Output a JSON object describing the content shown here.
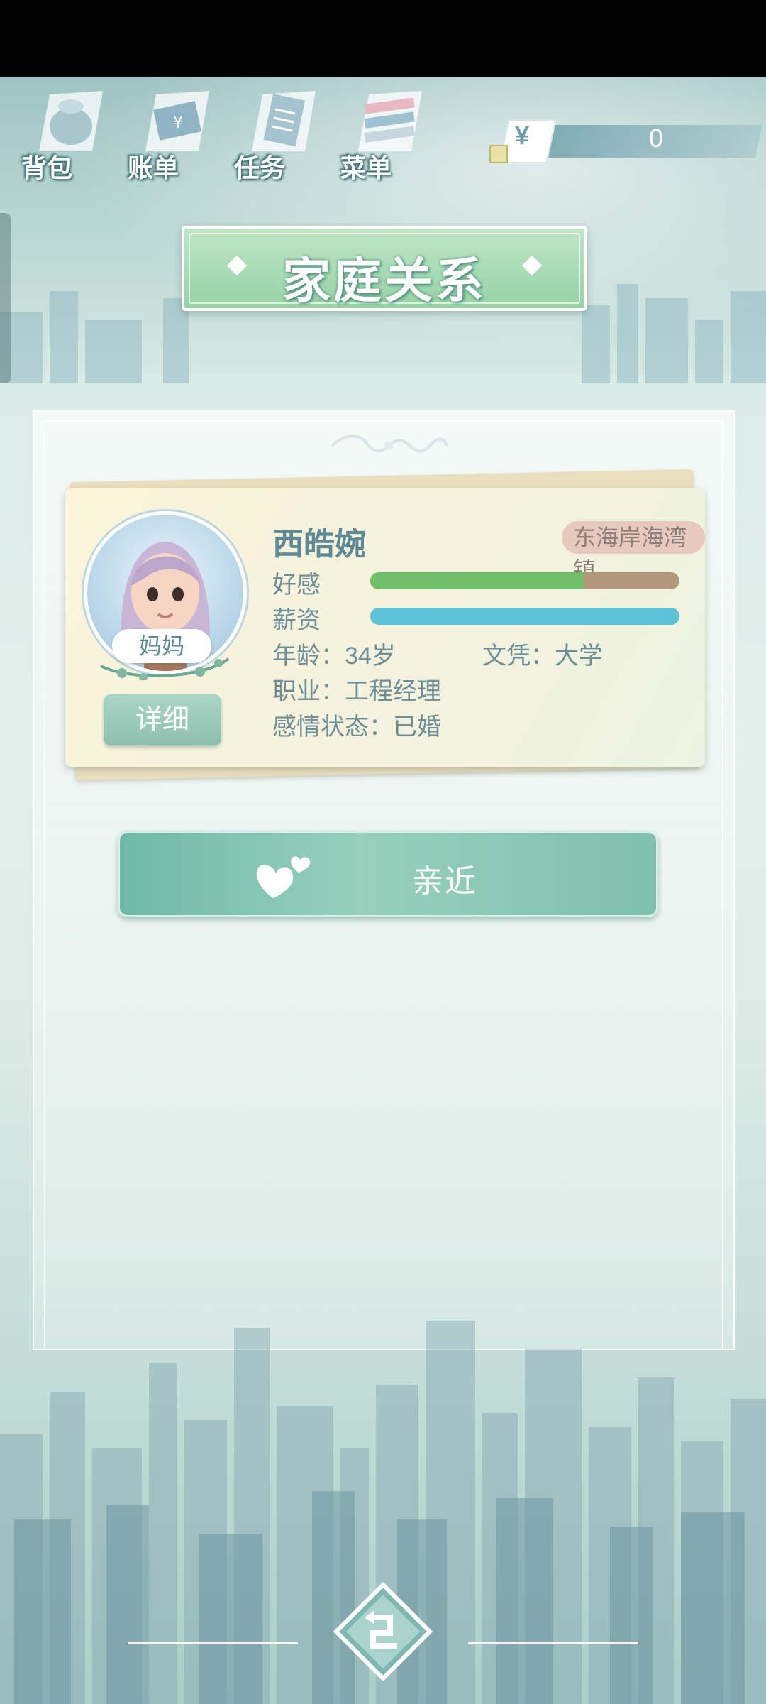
{
  "toolbar": {
    "items": [
      {
        "label": "背包",
        "icon": "bag-icon"
      },
      {
        "label": "账单",
        "icon": "bill-icon"
      },
      {
        "label": "任务",
        "icon": "task-icon"
      },
      {
        "label": "菜单",
        "icon": "menu-icon"
      }
    ]
  },
  "currency": {
    "symbol": "¥",
    "amount": "0"
  },
  "page": {
    "title": "家庭关系"
  },
  "character": {
    "name": "西皓婉",
    "role": "妈妈",
    "location": "东海岸海湾镇",
    "affection_label": "好感",
    "affection_level": 0.69,
    "salary_label": "薪资",
    "salary_level": 1.0,
    "age": "年龄：34岁",
    "education": "文凭：大学",
    "occupation": "职业：工程经理",
    "relationship": "感情状态：已婚",
    "detail_button": "详细"
  },
  "actions": {
    "approach_label": "亲近"
  },
  "colors": {
    "affection_fill": "#6fc069",
    "affection_track": "#b2977a",
    "salary_fill": "#5ec2d6",
    "accent_green": "#8ebfae",
    "name_color": "#5d8a96"
  }
}
